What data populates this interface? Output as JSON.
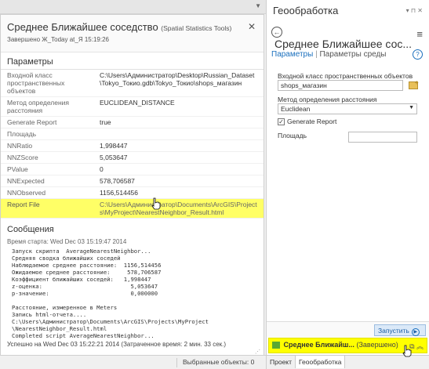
{
  "popup": {
    "title": "Среднее Ближайшее соседство",
    "subtitle": "(Spatial Statistics Tools)",
    "status": "Завершено Ж_Today at_Я 15:19:26",
    "params_title": "Параметры",
    "params": [
      {
        "name": "Входной класс пространственных объектов",
        "value": "C:\\Users\\Администратор\\Desktop\\Russian_Dataset\\Tokyo_Токио.gdb\\Tokyo_Токио\\shops_магазин"
      },
      {
        "name": "Метод определения расстояния",
        "value": "EUCLIDEAN_DISTANCE"
      },
      {
        "name": "Generate Report",
        "value": "true"
      },
      {
        "name": "Площадь",
        "value": ""
      },
      {
        "name": "NNRatio",
        "value": "1,998447"
      },
      {
        "name": "NNZScore",
        "value": "5,053647"
      },
      {
        "name": "PValue",
        "value": "0"
      },
      {
        "name": "NNExpected",
        "value": "578,706587"
      },
      {
        "name": "NNObserved",
        "value": "1156,514456"
      }
    ],
    "report": {
      "name": "Report File",
      "value": "C:\\Users\\Администратор\\Documents\\ArcGIS\\Projects\\MyProject\\NearestNeighbor_Result.html"
    },
    "messages_title": "Сообщения",
    "start_time": "Время старта: Wed Dec 03 15:19:47 2014",
    "log": "Запуск скрипта  AverageNearestNeighbor...\nСредняя сводка ближайших соседей\nНаблюдаемое среднее расстояние:  1156,514456\nОжидаемое среднее расстояние:     578,706587\nКоэффициент ближайших соседей:   1,998447\nz-оценка:                          5,053647\np-значение:                        0,000000\n\nРасстояние, измеренное в Meters\nЗапись html-отчета....\nC:\\Users\\Администратор\\Documents\\ArcGIS\\Projects\\MyProject\n\\NearestNeighbor_Result.html\nCompleted script AverageNearestNeighbor...",
    "end": "Успешно на Wed Dec 03 15:22:21 2014 (Затраченное время: 2 мин. 33 сек.)",
    "close_glyph": "✕"
  },
  "statusbar": {
    "selected": "Выбранные объекты: 0"
  },
  "gp": {
    "pane_title": "Геообработка",
    "pane_controls": "▾ ⊓ ✕",
    "tool_title": "Среднее Ближайшее сос...",
    "tab_params": "Параметры",
    "tab_env": "Параметры среды",
    "help": "?",
    "input_label": "Входной класс пространственных объектов",
    "input_value": "shops_магазин",
    "method_label": "Метод определения расстояния",
    "method_value": "Euclidean",
    "report_label": "Generate Report",
    "area_label": "Площадь",
    "run_label": "Запустить",
    "done_title": "Среднее Ближайш...",
    "done_status": "(Завершено)",
    "tab_project": "Проект",
    "tab_gp": "Геообработка"
  }
}
